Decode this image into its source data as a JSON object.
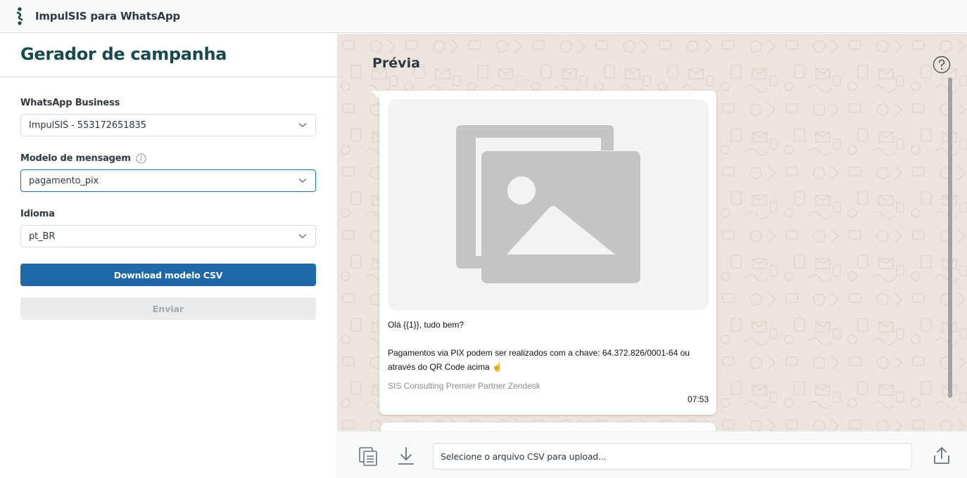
{
  "app": {
    "title": "ImpulSIS para WhatsApp",
    "logo_icon": "impulsis-logo-icon",
    "accent_color": "#17494d"
  },
  "campaign": {
    "page_title": "Gerador de campanha",
    "whatsapp_business": {
      "label": "WhatsApp Business",
      "value": "ImpulSIS - 553172651835"
    },
    "message_template": {
      "label": "Modelo de mensagem",
      "value": "pagamento_pix",
      "info_icon": "info-icon"
    },
    "language": {
      "label": "Idioma",
      "value": "pt_BR"
    },
    "download_button": "Download modelo CSV",
    "send_button": "Enviar",
    "primary_color": "#1f67ab"
  },
  "preview": {
    "title": "Prévia",
    "help_icon": "help-icon",
    "message": {
      "media_icon": "image-placeholder-icon",
      "line1": "Olá {{1}}, tudo bem?",
      "line2": "Pagamentos via PIX podem ser realizados com a chave: 64.372.826/0001-64 ou através do QR Code acima ☝️",
      "footer": "SIS Consulting Premier Partner Zendesk",
      "time": "07:53"
    }
  },
  "bottombar": {
    "copy_icon": "copy-icon",
    "download_icon": "download-icon",
    "upload_placeholder": "Selecione o arquivo CSV para upload...",
    "upload_icon": "upload-icon"
  }
}
